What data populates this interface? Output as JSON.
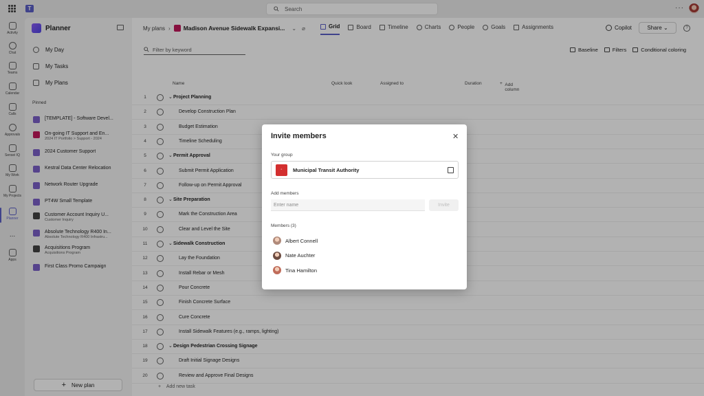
{
  "topbar": {
    "search_placeholder": "Search"
  },
  "rail": [
    {
      "label": "Activity"
    },
    {
      "label": "Chat"
    },
    {
      "label": "Teams"
    },
    {
      "label": "Calendar"
    },
    {
      "label": "Calls"
    },
    {
      "label": "Approvals"
    },
    {
      "label": "Sensei IQ"
    },
    {
      "label": "My Work"
    },
    {
      "label": "My Projects"
    },
    {
      "label": "Planner"
    },
    {
      "label": "..."
    },
    {
      "label": "Apps"
    }
  ],
  "sidebar": {
    "title": "Planner",
    "nav": [
      {
        "label": "My Day"
      },
      {
        "label": "My Tasks"
      },
      {
        "label": "My Plans"
      }
    ],
    "pinned_label": "Pinned",
    "pinned": [
      {
        "label": "[TEMPLATE] - Software Devel...",
        "sub": "",
        "color": "#7b61c9"
      },
      {
        "label": "On-going IT Support and En...",
        "sub": "2024 IT Portfolio > Support - 2024",
        "color": "#c2185b"
      },
      {
        "label": "2024 Customer Support",
        "sub": "",
        "color": "#7b61c9"
      },
      {
        "label": "Kestral Data Center Relocation",
        "sub": "",
        "color": "#7b61c9"
      },
      {
        "label": "Network Router Upgrade",
        "sub": "",
        "color": "#7b61c9"
      },
      {
        "label": "PT4W Small Template",
        "sub": "",
        "color": "#7b61c9"
      },
      {
        "label": "Customer Account Inquiry U...",
        "sub": "Customer Inquiry",
        "color": "#424242"
      },
      {
        "label": "Absolute Technology R400 In...",
        "sub": "Absolute Technology R400 Infrastru...",
        "color": "#7b61c9"
      },
      {
        "label": "Acquisitions Program",
        "sub": "Acquisitions Program",
        "color": "#424242"
      },
      {
        "label": "First Class Promo Campaign",
        "sub": "",
        "color": "#7b61c9"
      }
    ],
    "new_plan": "New plan"
  },
  "main": {
    "breadcrumb_root": "My plans",
    "plan_title": "Madison Avenue Sidewalk Expansi...",
    "tabs": [
      {
        "label": "Grid"
      },
      {
        "label": "Board"
      },
      {
        "label": "Timeline"
      },
      {
        "label": "Charts"
      },
      {
        "label": "People"
      },
      {
        "label": "Goals"
      },
      {
        "label": "Assignments"
      }
    ],
    "copilot": "Copilot",
    "share": "Share",
    "filter_placeholder": "Filter by keyword",
    "toolbar": {
      "baseline": "Baseline",
      "filters": "Filters",
      "conditional": "Conditional coloring"
    },
    "columns": {
      "name": "Name",
      "quick_look": "Quick look",
      "assigned_to": "Assigned to",
      "duration": "Duration",
      "add_column": "Add column"
    },
    "rows": [
      {
        "num": "1",
        "name": "Project Planning",
        "group": true
      },
      {
        "num": "2",
        "name": "Develop Construction Plan",
        "group": false
      },
      {
        "num": "3",
        "name": "Budget Estimation",
        "group": false
      },
      {
        "num": "4",
        "name": "Timeline Scheduling",
        "group": false
      },
      {
        "num": "5",
        "name": "Permit Approval",
        "group": true
      },
      {
        "num": "6",
        "name": "Submit Permit Application",
        "group": false
      },
      {
        "num": "7",
        "name": "Follow-up on Permit Approval",
        "group": false
      },
      {
        "num": "8",
        "name": "Site Preparation",
        "group": true
      },
      {
        "num": "9",
        "name": "Mark the Construction Area",
        "group": false
      },
      {
        "num": "10",
        "name": "Clear and Level the Site",
        "group": false
      },
      {
        "num": "11",
        "name": "Sidewalk Construction",
        "group": true
      },
      {
        "num": "12",
        "name": "Lay the Foundation",
        "group": false
      },
      {
        "num": "13",
        "name": "Install Rebar or Mesh",
        "group": false
      },
      {
        "num": "14",
        "name": "Pour Concrete",
        "group": false
      },
      {
        "num": "15",
        "name": "Finish Concrete Surface",
        "group": false
      },
      {
        "num": "16",
        "name": "Cure Concrete",
        "group": false
      },
      {
        "num": "17",
        "name": "Install Sidewalk Features (e.g., ramps, lighting)",
        "group": false
      },
      {
        "num": "18",
        "name": "Design Pedestrian Crossing Signage",
        "group": true
      },
      {
        "num": "19",
        "name": "Draft Initial Signage Designs",
        "group": false
      },
      {
        "num": "20",
        "name": "Review and Approve Final Designs",
        "group": false
      }
    ],
    "add_task": "Add new task"
  },
  "dialog": {
    "title": "Invite members",
    "your_group_label": "Your group",
    "group_name": "Municipal Transit Authority",
    "add_members_label": "Add members",
    "name_placeholder": "Enter name",
    "invite_button": "Invite",
    "members_label": "Members (3)",
    "members": [
      {
        "name": "Albert Connell",
        "color": "#b08a7a"
      },
      {
        "name": "Nate Auchter",
        "color": "#6d4c41"
      },
      {
        "name": "Tina Hamilton",
        "color": "#c06c5a"
      }
    ]
  }
}
